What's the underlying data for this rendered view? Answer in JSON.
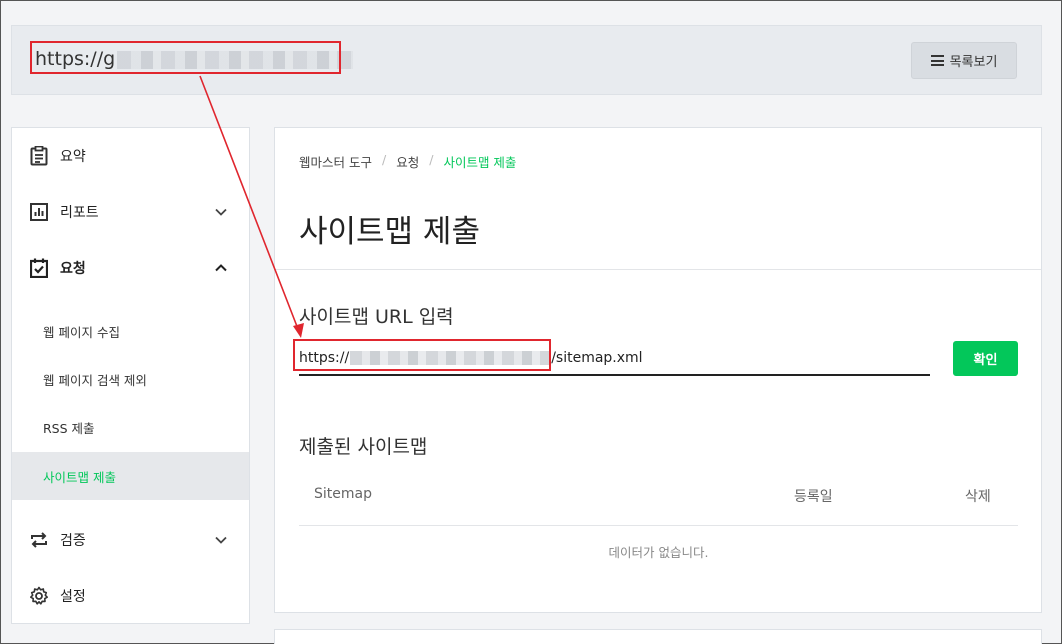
{
  "site_bar": {
    "url_prefix": "https://g",
    "list_button_label": "목록보기"
  },
  "sidebar": {
    "items": [
      {
        "label": "요약",
        "icon": "summary-icon"
      },
      {
        "label": "리포트",
        "icon": "report-icon"
      },
      {
        "label": "요청",
        "icon": "request-icon"
      },
      {
        "label": "검증",
        "icon": "verify-icon"
      },
      {
        "label": "설정",
        "icon": "gear-icon"
      }
    ],
    "sub_items": [
      {
        "label": "웹 페이지 수집"
      },
      {
        "label": "웹 페이지 검색 제외"
      },
      {
        "label": "RSS 제출"
      },
      {
        "label": "사이트맵 제출"
      }
    ]
  },
  "main": {
    "breadcrumb": [
      "웹마스터 도구",
      "요청",
      "사이트맵 제출"
    ],
    "title": "사이트맵 제출",
    "url_section_title": "사이트맵 URL 입력",
    "url_input_prefix": "https://",
    "url_input_suffix": "/sitemap.xml",
    "confirm_label": "확인",
    "submitted_title": "제출된 사이트맵",
    "table_headers": [
      "Sitemap",
      "등록일",
      "삭제"
    ],
    "empty_text": "데이터가 없습니다."
  },
  "colors": {
    "accent": "#03c75a",
    "annotation": "#e0262e"
  }
}
